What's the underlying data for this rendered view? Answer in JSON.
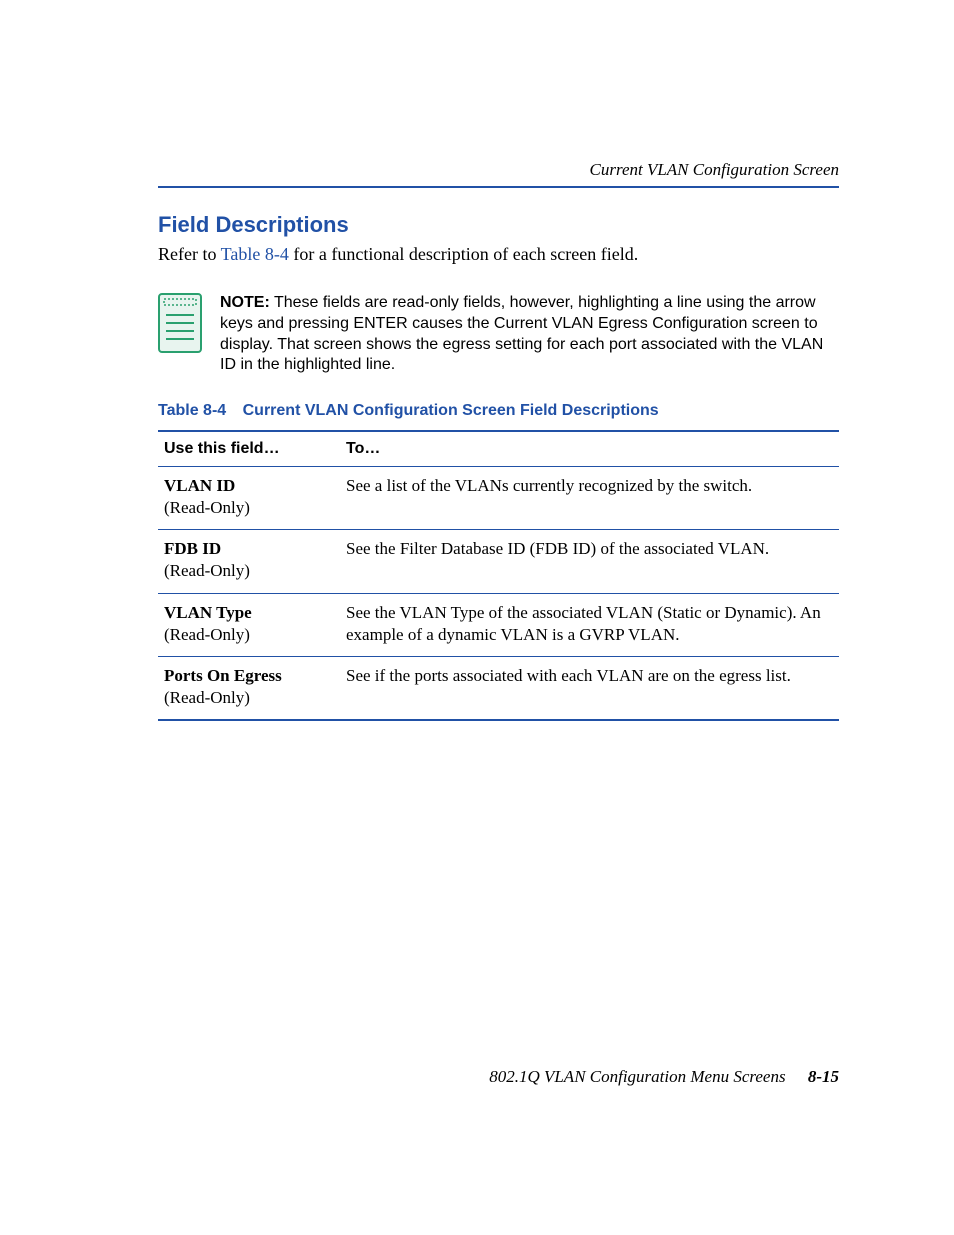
{
  "header": {
    "running_title": "Current VLAN Configuration Screen"
  },
  "section": {
    "heading": "Field Descriptions",
    "intro_pre": "Refer to ",
    "intro_link": "Table 8-4",
    "intro_post": " for a functional description of each screen field."
  },
  "note": {
    "label": "NOTE:",
    "body": "These fields are read-only fields, however, highlighting a line using the arrow keys and pressing ENTER causes the Current VLAN Egress Configuration screen to display. That screen shows the egress setting for each port associated with the VLAN ID in the highlighted line."
  },
  "table": {
    "caption_number": "Table 8-4",
    "caption_title": "Current VLAN Configuration Screen Field Descriptions",
    "headers": {
      "col1": "Use this field…",
      "col2": "To…"
    },
    "rows": [
      {
        "field_name": "VLAN ID",
        "field_sub": "(Read-Only)",
        "desc": "See a list of the VLANs currently recognized by the switch."
      },
      {
        "field_name": "FDB ID",
        "field_sub": "(Read-Only)",
        "desc": "See the Filter Database ID (FDB ID) of the associated VLAN."
      },
      {
        "field_name": "VLAN Type",
        "field_sub": "(Read-Only)",
        "desc": "See the VLAN Type of the associated VLAN (Static or Dynamic). An example of a dynamic VLAN is a GVRP VLAN."
      },
      {
        "field_name": "Ports On Egress",
        "field_sub": "(Read-Only)",
        "desc": "See if the ports associated with each VLAN are on the egress list."
      }
    ]
  },
  "footer": {
    "book_title": "802.1Q VLAN Configuration Menu Screens",
    "page_number": "8-15"
  }
}
